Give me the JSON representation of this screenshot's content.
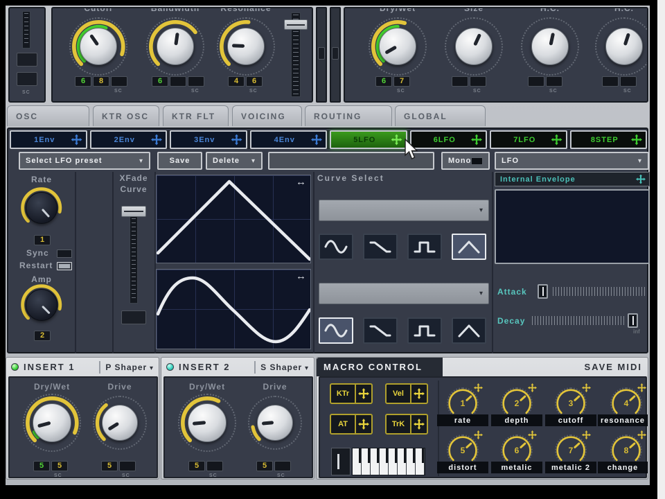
{
  "top": {
    "filter": {
      "label_cutoff": "Cutoff",
      "label_bandwidth": "Bandwidth",
      "label_resonance": "Resonance",
      "cutoff_values": [
        "6",
        "8"
      ],
      "bandwidth_value": "6",
      "resonance_values": [
        "4",
        "6"
      ],
      "sc": "SC"
    },
    "fx": {
      "label_drywet": "Dry/Wet",
      "label_size": "Size",
      "label_hc1": "H.C.",
      "label_hc2": "H.C.",
      "drywet_values": [
        "6",
        "7"
      ],
      "sc": "SC"
    },
    "sidebar_sc": "SC"
  },
  "main_tabs": [
    {
      "label": "OSC"
    },
    {
      "label": "KTR OSC"
    },
    {
      "label": "KTR FLT"
    },
    {
      "label": "VOICING"
    },
    {
      "label": "ROUTING"
    },
    {
      "label": "GLOBAL"
    }
  ],
  "mod_tabs": [
    {
      "label": "1Env"
    },
    {
      "label": "2Env"
    },
    {
      "label": "3Env"
    },
    {
      "label": "4Env"
    },
    {
      "label": "5LFO"
    },
    {
      "label": "6LFO"
    },
    {
      "label": "7LFO"
    },
    {
      "label": "8STEP"
    }
  ],
  "preset_bar": {
    "preset_dropdown": "Select LFO preset",
    "save": "Save",
    "delete": "Delete",
    "mono": "Mono",
    "type_dropdown": "LFO"
  },
  "lfo_editor": {
    "rate_label": "Rate",
    "rate_value": "1",
    "sync_label": "Sync",
    "restart_label": "Restart",
    "amp_label": "Amp",
    "amp_value": "2",
    "xfade_line1": "XFade",
    "xfade_line2": "Curve",
    "curve_select_title": "Curve Select",
    "internal_envelope": "Internal Envelope",
    "attack_label": "Attack",
    "decay_label": "Decay",
    "inf_label": "inf"
  },
  "inserts": [
    {
      "title": "INSERT 1",
      "shaper": "P Shaper",
      "drywet_label": "Dry/Wet",
      "drive_label": "Drive",
      "drywet_values": [
        "5",
        "5"
      ],
      "drive_value": "5",
      "sc": "SC"
    },
    {
      "title": "INSERT 2",
      "shaper": "S Shaper",
      "drywet_label": "Dry/Wet",
      "drive_label": "Drive",
      "drywet_values": [
        "5"
      ],
      "drive_value": "5",
      "sc": "SC"
    }
  ],
  "macro": {
    "title": "MACRO CONTROL",
    "save_midi": "SAVE MIDI",
    "sources": [
      {
        "label": "KTr"
      },
      {
        "label": "Vel"
      },
      {
        "label": "AT"
      },
      {
        "label": "TrK"
      }
    ],
    "knobs": [
      {
        "num": "1",
        "label": "rate"
      },
      {
        "num": "2",
        "label": "depth"
      },
      {
        "num": "3",
        "label": "cutoff"
      },
      {
        "num": "4",
        "label": "resonance"
      },
      {
        "num": "5",
        "label": "distort"
      },
      {
        "num": "6",
        "label": "metalic"
      },
      {
        "num": "7",
        "label": "metalic 2"
      },
      {
        "num": "8",
        "label": "change"
      }
    ]
  },
  "colors": {
    "accent_yellow": "#e2c43a",
    "accent_green": "#44d22e",
    "accent_blue": "#4a86d8",
    "accent_teal": "#52c4bc",
    "panel_dark": "#363b48",
    "display_navy": "#101628"
  }
}
